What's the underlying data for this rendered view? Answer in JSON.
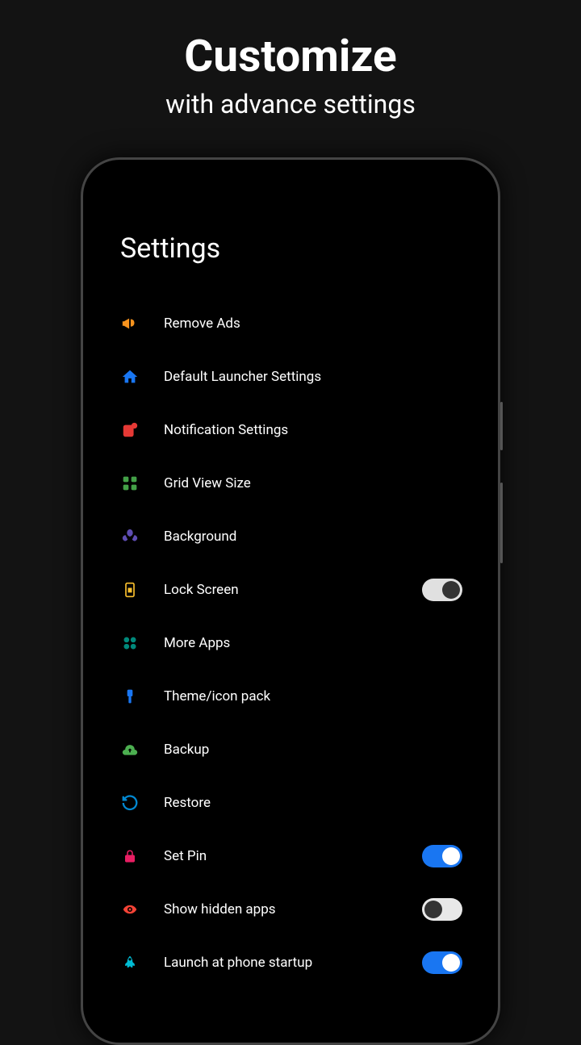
{
  "hero": {
    "title": "Customize",
    "subtitle": "with advance settings"
  },
  "screen": {
    "title": "Settings"
  },
  "items": [
    {
      "label": "Remove Ads",
      "icon": "megaphone",
      "color": "#f7931e",
      "toggle": null
    },
    {
      "label": "Default Launcher Settings",
      "icon": "home",
      "color": "#1976f2",
      "toggle": null
    },
    {
      "label": "Notification Settings",
      "icon": "notification",
      "color": "#e53935",
      "toggle": null
    },
    {
      "label": "Grid View Size",
      "icon": "grid",
      "color": "#43a047",
      "toggle": null
    },
    {
      "label": "Background",
      "icon": "flower",
      "color": "#5e4db2",
      "toggle": null
    },
    {
      "label": "Lock Screen",
      "icon": "lock",
      "color": "#fbc02d",
      "toggle": "off"
    },
    {
      "label": "More Apps",
      "icon": "apps",
      "color": "#00897b",
      "toggle": null
    },
    {
      "label": "Theme/icon pack",
      "icon": "brush",
      "color": "#1976f2",
      "toggle": null
    },
    {
      "label": "Backup",
      "icon": "cloud-up",
      "color": "#4caf50",
      "toggle": null
    },
    {
      "label": "Restore",
      "icon": "restore",
      "color": "#0288d1",
      "toggle": null
    },
    {
      "label": "Set Pin",
      "icon": "pin-lock",
      "color": "#e91e63",
      "toggle": "on"
    },
    {
      "label": "Show hidden apps",
      "icon": "eye",
      "color": "#f44336",
      "toggle": "off-left"
    },
    {
      "label": "Launch at phone startup",
      "icon": "rocket",
      "color": "#00bcd4",
      "toggle": "on"
    }
  ]
}
